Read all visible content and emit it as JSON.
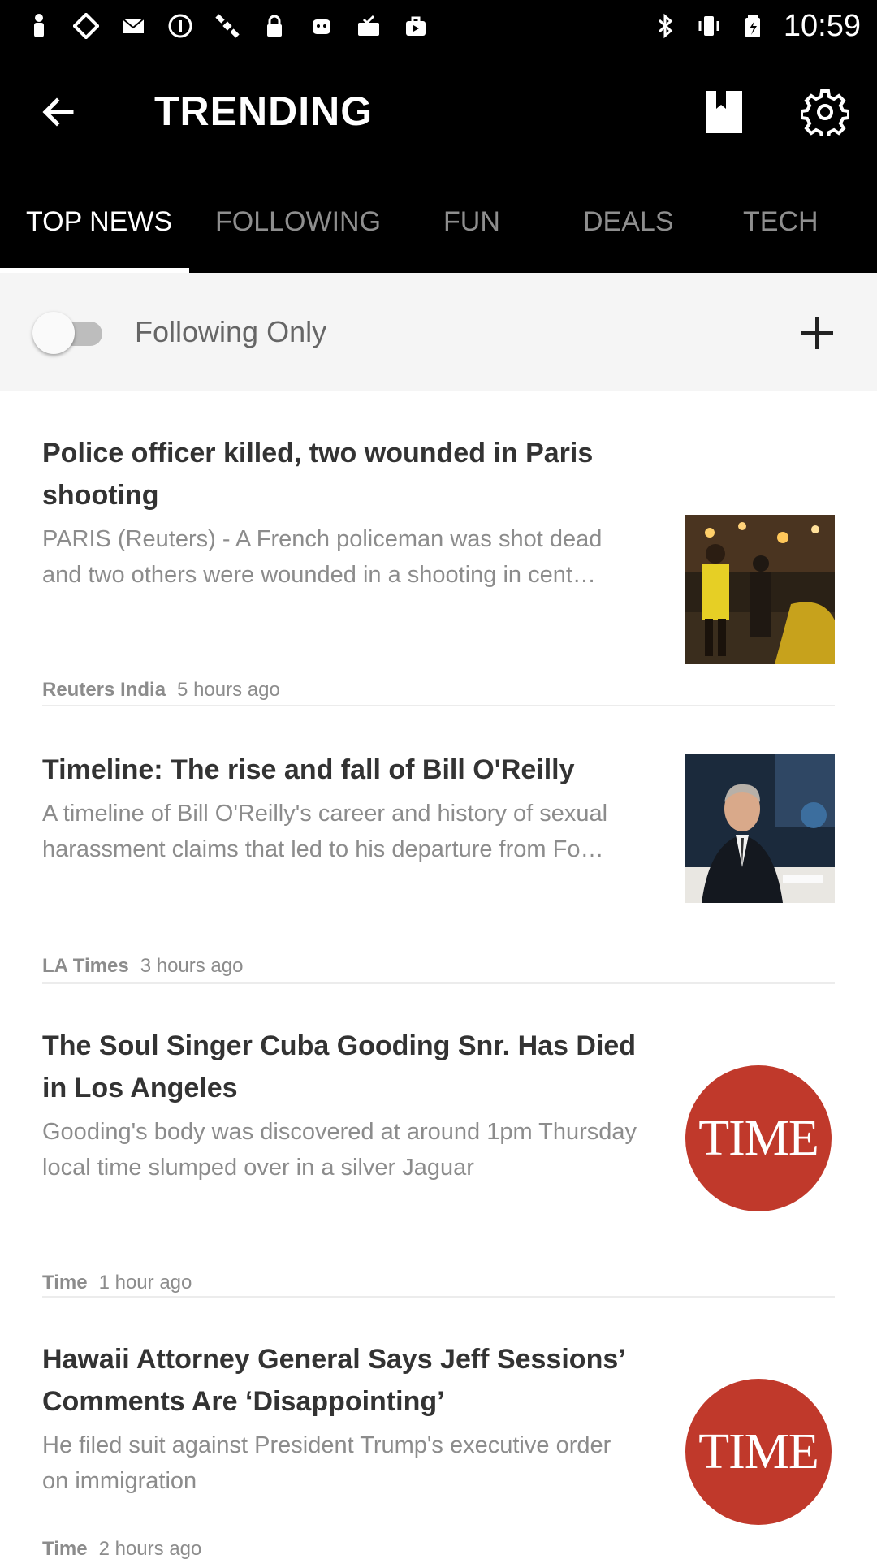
{
  "status_bar": {
    "time": "10:59"
  },
  "app_bar": {
    "title": "TRENDING"
  },
  "tabs": [
    {
      "label": "TOP NEWS",
      "active": true
    },
    {
      "label": "FOLLOWING",
      "active": false
    },
    {
      "label": "FUN",
      "active": false
    },
    {
      "label": "DEALS",
      "active": false
    },
    {
      "label": "TECH",
      "active": false
    }
  ],
  "filter": {
    "label": "Following Only",
    "toggle_on": false
  },
  "articles": [
    {
      "headline": "Police officer killed, two wounded in Paris shooting",
      "summary": "PARIS (Reuters) - A French policeman was shot dead and two others were wounded in a shooting in cent…",
      "source": "Reuters India",
      "time": "5 hours ago",
      "thumb": "photo"
    },
    {
      "headline": "Timeline: The rise and fall of Bill O'Reilly",
      "summary": "A timeline of Bill O'Reilly's career and history of sexual harassment claims that led to his departure from Fo…",
      "source": "LA Times",
      "time": "3 hours ago",
      "thumb": "photo"
    },
    {
      "headline": "The Soul Singer Cuba Gooding Snr. Has Died in Los Angeles",
      "summary": "Gooding's body was discovered at around 1pm Thursday local time slumped over in a silver Jaguar",
      "source": "Time",
      "time": "1 hour ago",
      "thumb": "TIME"
    },
    {
      "headline": "Hawaii Attorney General Says Jeff Sessions’ Comments Are ‘Disappointing’",
      "summary": "He filed suit against President Trump's executive order on immigration",
      "source": "Time",
      "time": "2 hours ago",
      "thumb": "TIME"
    }
  ],
  "colors": {
    "header_bg": "#000000",
    "time_logo_red": "#c0392b",
    "filter_bg": "#f5f5f5"
  }
}
